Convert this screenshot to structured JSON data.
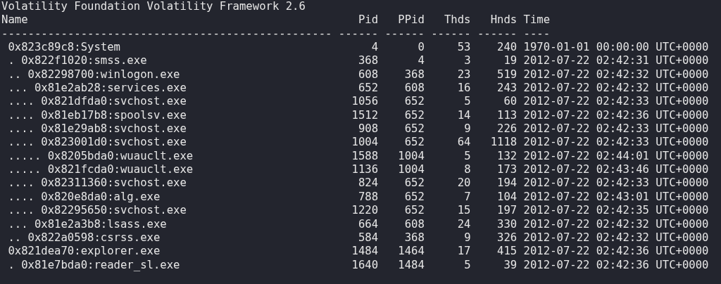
{
  "title": "Volatility Foundation Volatility Framework 2.6",
  "columns": [
    "Name",
    "Pid",
    "PPid",
    "Thds",
    "Hnds",
    "Time"
  ],
  "rules": [
    "--------------------------------------------------",
    "------",
    "------",
    "------",
    "------",
    "----"
  ],
  "rows": [
    [
      "0x823c89c8:System",
      "4",
      "0",
      "53",
      "240",
      "1970-01-01 00:00:00 UTC+0000"
    ],
    [
      ". 0x822f1020:smss.exe",
      "368",
      "4",
      "3",
      "19",
      "2012-07-22 02:42:31 UTC+0000"
    ],
    [
      ".. 0x82298700:winlogon.exe",
      "608",
      "368",
      "23",
      "519",
      "2012-07-22 02:42:32 UTC+0000"
    ],
    [
      "... 0x81e2ab28:services.exe",
      "652",
      "608",
      "16",
      "243",
      "2012-07-22 02:42:32 UTC+0000"
    ],
    [
      ".... 0x821dfda0:svchost.exe",
      "1056",
      "652",
      "5",
      "60",
      "2012-07-22 02:42:33 UTC+0000"
    ],
    [
      ".... 0x81eb17b8:spoolsv.exe",
      "1512",
      "652",
      "14",
      "113",
      "2012-07-22 02:42:36 UTC+0000"
    ],
    [
      ".... 0x81e29ab8:svchost.exe",
      "908",
      "652",
      "9",
      "226",
      "2012-07-22 02:42:33 UTC+0000"
    ],
    [
      ".... 0x823001d0:svchost.exe",
      "1004",
      "652",
      "64",
      "1118",
      "2012-07-22 02:42:33 UTC+0000"
    ],
    [
      "..... 0x8205bda0:wuauclt.exe",
      "1588",
      "1004",
      "5",
      "132",
      "2012-07-22 02:44:01 UTC+0000"
    ],
    [
      "..... 0x821fcda0:wuauclt.exe",
      "1136",
      "1004",
      "8",
      "173",
      "2012-07-22 02:43:46 UTC+0000"
    ],
    [
      ".... 0x82311360:svchost.exe",
      "824",
      "652",
      "20",
      "194",
      "2012-07-22 02:42:33 UTC+0000"
    ],
    [
      ".... 0x820e8da0:alg.exe",
      "788",
      "652",
      "7",
      "104",
      "2012-07-22 02:43:01 UTC+0000"
    ],
    [
      ".... 0x82295650:svchost.exe",
      "1220",
      "652",
      "15",
      "197",
      "2012-07-22 02:42:35 UTC+0000"
    ],
    [
      "... 0x81e2a3b8:lsass.exe",
      "664",
      "608",
      "24",
      "330",
      "2012-07-22 02:42:32 UTC+0000"
    ],
    [
      ".. 0x822a0598:csrss.exe",
      "584",
      "368",
      "9",
      "326",
      "2012-07-22 02:42:32 UTC+0000"
    ],
    [
      "0x821dea70:explorer.exe",
      "1484",
      "1464",
      "17",
      "415",
      "2012-07-22 02:42:36 UTC+0000"
    ],
    [
      ". 0x81e7bda0:reader_sl.exe",
      "1640",
      "1484",
      "5",
      "39",
      "2012-07-22 02:42:36 UTC+0000"
    ]
  ]
}
